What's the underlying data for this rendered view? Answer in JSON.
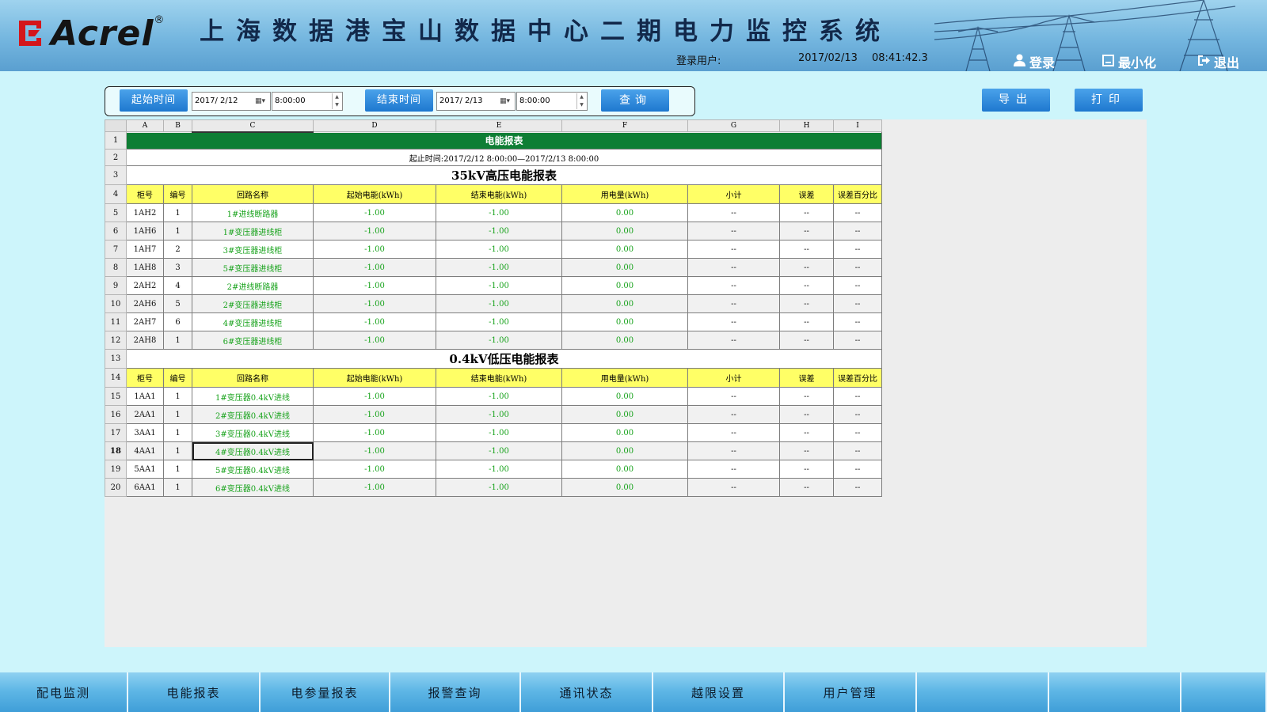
{
  "header": {
    "logo_text": "Acrel",
    "logo_reg": "®",
    "title": "上海数据港宝山数据中心二期电力监控系统",
    "login_user_label": "登录用户:",
    "date": "2017/02/13",
    "time": "08:41:42.3",
    "login_label": "登录",
    "minimize_label": "最小化",
    "exit_label": "退出"
  },
  "query": {
    "start_label": "起始时间",
    "start_date": "2017/ 2/12",
    "start_time": "8:00:00",
    "end_label": "结束时间",
    "end_date": "2017/ 2/13",
    "end_time": "8:00:00",
    "query_label": "查询",
    "export_label": "导出",
    "print_label": "打印"
  },
  "sheet": {
    "columns": [
      "A",
      "B",
      "C",
      "D",
      "E",
      "F",
      "G",
      "H",
      "I"
    ],
    "row_numbers": [
      "1",
      "2",
      "3",
      "4",
      "5",
      "6",
      "7",
      "8",
      "9",
      "10",
      "11",
      "12",
      "13",
      "14",
      "15",
      "16",
      "17",
      "18",
      "19",
      "20"
    ],
    "title": "电能报表",
    "range_text": "起止时间:2017/2/12 8:00:00—2017/2/13 8:00:00",
    "section1_title": "35kV高压电能报表",
    "section2_title": "0.4kV低压电能报表",
    "headers": [
      "柜号",
      "编号",
      "回路名称",
      "起始电能(kWh)",
      "结束电能(kWh)",
      "用电量(kWh)",
      "小计",
      "误差",
      "误差百分比"
    ],
    "section1_rows": [
      [
        "1AH2",
        "1",
        "1#进线断路器",
        "-1.00",
        "-1.00",
        "0.00",
        "--",
        "--",
        "--"
      ],
      [
        "1AH6",
        "1",
        "1#变压器进线柜",
        "-1.00",
        "-1.00",
        "0.00",
        "--",
        "--",
        "--"
      ],
      [
        "1AH7",
        "2",
        "3#变压器进线柜",
        "-1.00",
        "-1.00",
        "0.00",
        "--",
        "--",
        "--"
      ],
      [
        "1AH8",
        "3",
        "5#变压器进线柜",
        "-1.00",
        "-1.00",
        "0.00",
        "--",
        "--",
        "--"
      ],
      [
        "2AH2",
        "4",
        "2#进线断路器",
        "-1.00",
        "-1.00",
        "0.00",
        "--",
        "--",
        "--"
      ],
      [
        "2AH6",
        "5",
        "2#变压器进线柜",
        "-1.00",
        "-1.00",
        "0.00",
        "--",
        "--",
        "--"
      ],
      [
        "2AH7",
        "6",
        "4#变压器进线柜",
        "-1.00",
        "-1.00",
        "0.00",
        "--",
        "--",
        "--"
      ],
      [
        "2AH8",
        "1",
        "6#变压器进线柜",
        "-1.00",
        "-1.00",
        "0.00",
        "--",
        "--",
        "--"
      ]
    ],
    "section2_rows": [
      [
        "1AA1",
        "1",
        "1#变压器0.4kV进线",
        "-1.00",
        "-1.00",
        "0.00",
        "--",
        "--",
        "--"
      ],
      [
        "2AA1",
        "1",
        "2#变压器0.4kV进线",
        "-1.00",
        "-1.00",
        "0.00",
        "--",
        "--",
        "--"
      ],
      [
        "3AA1",
        "1",
        "3#变压器0.4kV进线",
        "-1.00",
        "-1.00",
        "0.00",
        "--",
        "--",
        "--"
      ],
      [
        "4AA1",
        "1",
        "4#变压器0.4kV进线",
        "-1.00",
        "-1.00",
        "0.00",
        "--",
        "--",
        "--"
      ],
      [
        "5AA1",
        "1",
        "5#变压器0.4kV进线",
        "-1.00",
        "-1.00",
        "0.00",
        "--",
        "--",
        "--"
      ],
      [
        "6AA1",
        "1",
        "6#变压器0.4kV进线",
        "-1.00",
        "-1.00",
        "0.00",
        "--",
        "--",
        "--"
      ]
    ],
    "selected_row": "18",
    "selected_column": "C"
  },
  "nav": {
    "items": [
      "配电监测",
      "电能报表",
      "电参量报表",
      "报警查询",
      "通讯状态",
      "越限设置",
      "用户管理",
      "",
      "",
      ""
    ]
  },
  "colors": {
    "title_green": "#0e7e34",
    "header_yellow": "#ffff66",
    "value_green": "#16a21a",
    "button_blue": "#2a86d8"
  }
}
